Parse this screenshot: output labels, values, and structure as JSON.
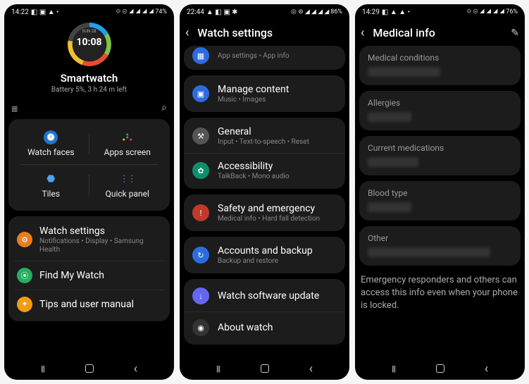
{
  "screen1": {
    "status": {
      "time": "14:22",
      "icons_left": "◧ ▣ ▲ •",
      "icons_right": "⟐ ⊜ ◢ ◢ ◢ ◢",
      "battery": "74%"
    },
    "watchface": {
      "day": "SUN 28",
      "time": "10:08"
    },
    "device_name": "Smartwatch",
    "battery_line": "Battery 5%, 3 h 24 m left",
    "grid": {
      "watch_faces": "Watch faces",
      "apps_screen": "Apps screen",
      "tiles": "Tiles",
      "quick_panel": "Quick panel"
    },
    "settings": {
      "title": "Watch settings",
      "sub": "Notifications • Display • Samsung Health"
    },
    "find": {
      "title": "Find My Watch"
    },
    "tips": {
      "title": "Tips and user manual"
    }
  },
  "screen2": {
    "status": {
      "time": "22:44",
      "icons_left": "▲ ◧ ▣ ✱",
      "icons_right": "◎ ⊜ ◢ ◢ ◢ ◢",
      "battery": "86%"
    },
    "title": "Watch settings",
    "apps_sub": "App settings • App info",
    "manage": {
      "title": "Manage content",
      "sub": "Music • Images"
    },
    "general": {
      "title": "General",
      "sub": "Input • Text-to-speech • Reset"
    },
    "accessibility": {
      "title": "Accessibility",
      "sub": "TalkBack • Mono audio"
    },
    "safety": {
      "title": "Safety and emergency",
      "sub": "Medical info • Hard fall detection"
    },
    "accounts": {
      "title": "Accounts and backup",
      "sub": "Backup and restore"
    },
    "update": {
      "title": "Watch software update"
    },
    "about": {
      "title": "About watch"
    }
  },
  "screen3": {
    "status": {
      "time": "14:29",
      "icons_left": "◧ ▲ ▲ •",
      "icons_right": "⟐ ⊜ ◢ ◢ ◢ ◢",
      "battery": "76%"
    },
    "title": "Medical info",
    "fields": {
      "conditions": "Medical conditions",
      "allergies": "Allergies",
      "medications": "Current medications",
      "blood": "Blood type",
      "other": "Other"
    },
    "notice": "Emergency responders and others can access this info even when your phone is locked."
  }
}
